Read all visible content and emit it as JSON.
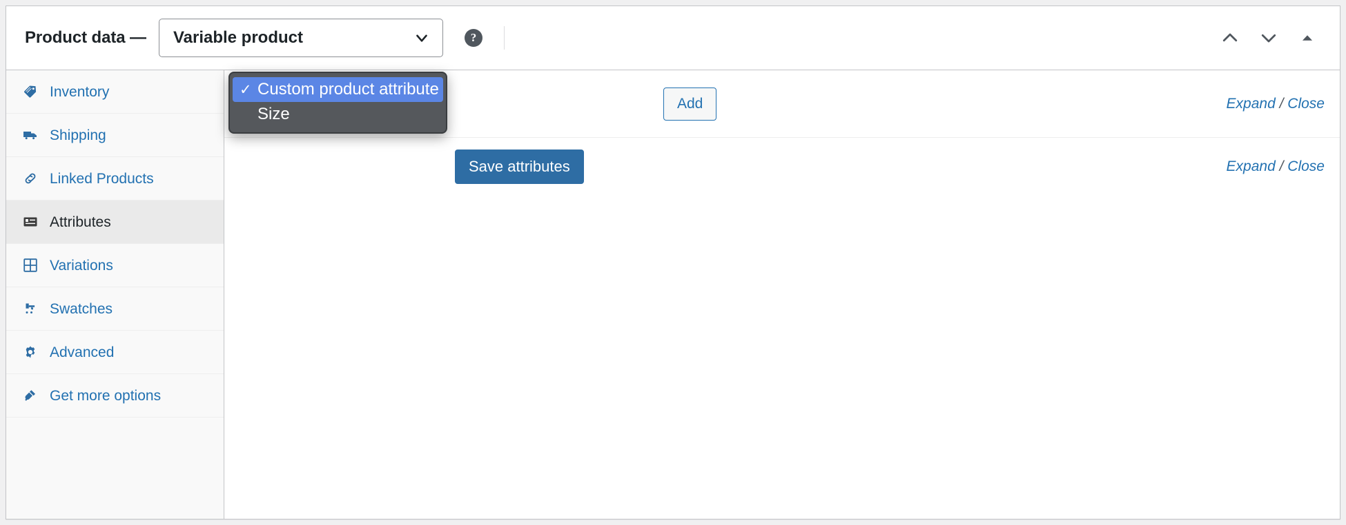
{
  "header": {
    "title": "Product data —",
    "product_type": {
      "value": "Variable product",
      "icon": "chevron-down-icon"
    },
    "help_icon": "help-circle-icon",
    "actions": [
      {
        "name": "move-up",
        "icon": "chevron-up-icon"
      },
      {
        "name": "move-down",
        "icon": "chevron-down-icon"
      },
      {
        "name": "toggle-panel",
        "icon": "triangle-up-icon"
      }
    ]
  },
  "sidebar": {
    "items": [
      {
        "label": "Inventory",
        "icon": "tag-icon",
        "active": false
      },
      {
        "label": "Shipping",
        "icon": "truck-icon",
        "active": false
      },
      {
        "label": "Linked Products",
        "icon": "link-icon",
        "active": false
      },
      {
        "label": "Attributes",
        "icon": "list-view-icon",
        "active": true
      },
      {
        "label": "Variations",
        "icon": "grid-icon",
        "active": false
      },
      {
        "label": "Swatches",
        "icon": "swatch-icon",
        "active": false
      },
      {
        "label": "Advanced",
        "icon": "gear-icon",
        "active": false
      },
      {
        "label": "Get more options",
        "icon": "plugin-icon",
        "active": false
      }
    ]
  },
  "content": {
    "add_row": {
      "add_button_label": "Add",
      "expand_label": "Expand",
      "separator": "/",
      "close_label": "Close"
    },
    "save_row": {
      "save_button_label": "Save attributes",
      "expand_label": "Expand",
      "separator": "/",
      "close_label": "Close"
    }
  },
  "select_popup": {
    "open": true,
    "options": [
      {
        "label": "Custom product attribute",
        "selected": true,
        "check": "✓"
      },
      {
        "label": "Size",
        "selected": false,
        "check": ""
      }
    ]
  },
  "colors": {
    "link_blue": "#2271b1",
    "primary_button": "#2e6da4",
    "popup_background": "#55585c",
    "popup_highlight": "#5b86e5",
    "panel_border": "#c3c4c7",
    "active_sidebar": "#eaeaea"
  }
}
